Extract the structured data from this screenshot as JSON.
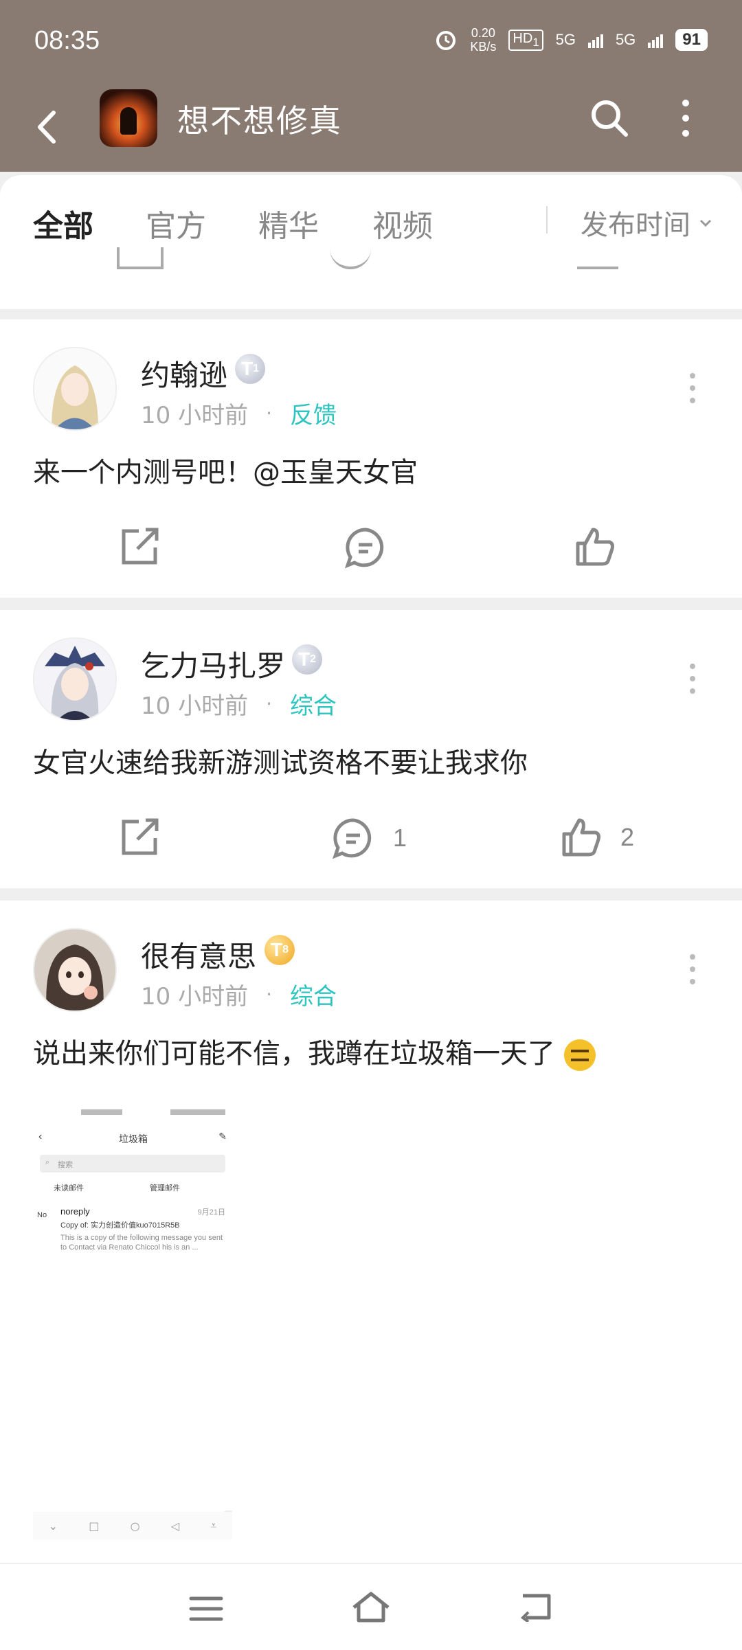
{
  "status_bar": {
    "time": "08:35",
    "net_speed_value": "0.20",
    "net_speed_unit": "KB/s",
    "hd_label": "HD",
    "sim1": "1",
    "sim2": "2",
    "network1": "5G",
    "network2": "5G",
    "battery": "91"
  },
  "header": {
    "title": "想不想修真"
  },
  "tabs": [
    {
      "label": "全部",
      "active": true
    },
    {
      "label": "官方",
      "active": false
    },
    {
      "label": "精华",
      "active": false
    },
    {
      "label": "视频",
      "active": false
    }
  ],
  "sort": {
    "label": "发布时间"
  },
  "posts": [
    {
      "username": "约翰逊",
      "level": "T",
      "level_num": "1",
      "time": "10 小时前",
      "category": "反馈",
      "text": "来一个内测号吧！@玉皇天女官",
      "comments": "",
      "likes": ""
    },
    {
      "username": "乞力马扎罗",
      "level": "T",
      "level_num": "2",
      "time": "10 小时前",
      "category": "综合",
      "text": "女官火速给我新游测试资格不要让我求你",
      "comments": "1",
      "likes": "2"
    },
    {
      "username": "很有意思",
      "level": "T",
      "level_num": "8",
      "time": "10 小时前",
      "category": "综合",
      "text": "说出来你们可能不信，我蹲在垃圾箱一天了",
      "thumbnail": {
        "title": "垃圾箱",
        "search_placeholder": "搜索",
        "btn1": "未读邮件",
        "btn2": "管理邮件",
        "sender": "noreply",
        "date": "9月21日",
        "subject": "Copy of: 实力创造价值kuo7015R5B",
        "preview": "This is a copy of the following message you sent to Contact via Renato Chiccol his is an ...",
        "avatar_text": "No"
      }
    }
  ],
  "colors": {
    "header_bg": "#8a7b72",
    "accent": "#2ec4c0"
  }
}
